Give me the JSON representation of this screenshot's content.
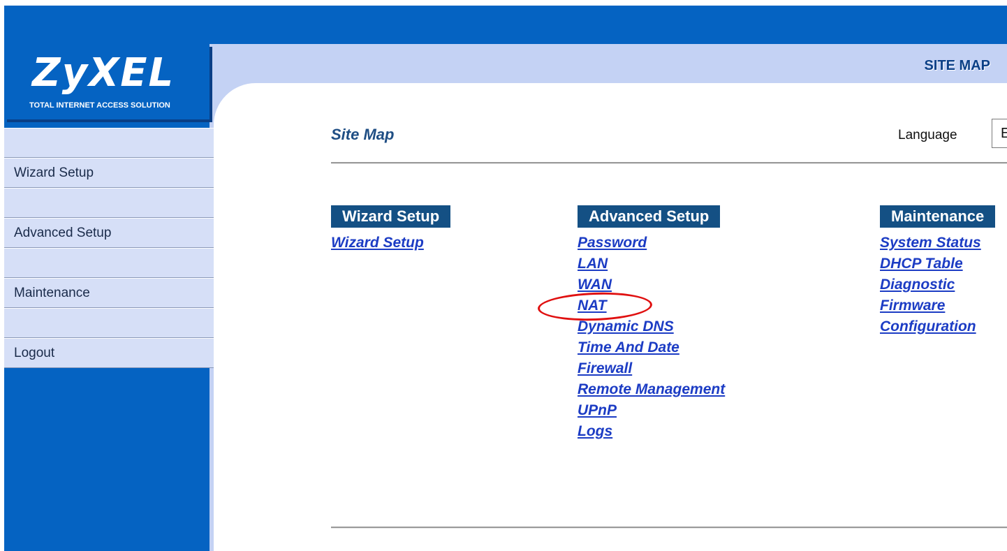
{
  "brand": {
    "logo_text": "ZyXEL",
    "tagline": "Total Internet Access Solution"
  },
  "header": {
    "title": "SITE MAP"
  },
  "sidebar": {
    "items": [
      {
        "label": ""
      },
      {
        "label": "Wizard Setup"
      },
      {
        "label": ""
      },
      {
        "label": "Advanced Setup"
      },
      {
        "label": ""
      },
      {
        "label": "Maintenance"
      },
      {
        "label": ""
      },
      {
        "label": "Logout"
      }
    ]
  },
  "main": {
    "title": "Site Map",
    "language_label": "Language",
    "language_value": "E",
    "columns": [
      {
        "heading": "Wizard Setup",
        "links": [
          "Wizard Setup"
        ]
      },
      {
        "heading": "Advanced Setup",
        "links": [
          "Password",
          "LAN",
          "WAN",
          "NAT",
          "Dynamic DNS",
          "Time And Date",
          "Firewall",
          "Remote Management",
          "UPnP",
          "Logs"
        ]
      },
      {
        "heading": "Maintenance",
        "links": [
          "System Status",
          "DHCP Table",
          "Diagnostic",
          "Firmware",
          "Configuration"
        ]
      }
    ]
  },
  "colors": {
    "brand_blue": "#0563c2",
    "header_light": "#c4d2f4",
    "link": "#1c3cc4",
    "annotation": "#e01010"
  }
}
